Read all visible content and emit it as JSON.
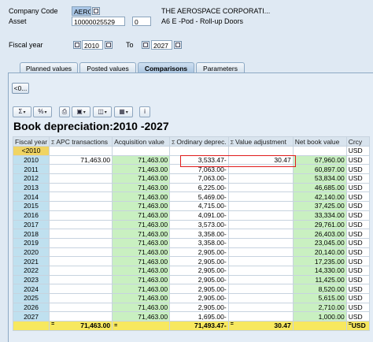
{
  "header": {
    "company_code_label": "Company Code",
    "company_code_value": "AERO",
    "company_name": "THE AEROSPACE CORPORATI...",
    "asset_label": "Asset",
    "asset_value": "10000025529",
    "asset_sub": "0",
    "asset_desc": "A6 E -Pod - Roll-up Doors",
    "fiscal_year_label": "Fiscal year",
    "fiscal_from": "2010",
    "to_label": "To",
    "fiscal_to": "2027"
  },
  "tabs": [
    {
      "label": "Planned values",
      "active": false
    },
    {
      "label": "Posted values",
      "active": false
    },
    {
      "label": "Comparisons",
      "active": true
    },
    {
      "label": "Parameters",
      "active": false
    }
  ],
  "back_button": "<0...",
  "toolbar_icons": [
    "sum-icon",
    "subtotal-icon",
    "print-icon",
    "view-icon",
    "export-icon",
    "layout-icon",
    "info-icon"
  ],
  "report_title": "Book depreciation:2010 -2027",
  "grid": {
    "columns": [
      "Fiscal year",
      "APC transactions",
      "Acquisition value",
      "Ordinary deprec.",
      "Value adjustment",
      "Net book value",
      "Crcy"
    ],
    "rows": [
      {
        "year": "<2010",
        "apc": "",
        "acq": "",
        "ord": "",
        "adj": "",
        "nbv": "",
        "crcy": "USD"
      },
      {
        "year": "2010",
        "apc": "71,463.00",
        "acq": "71,463.00",
        "ord": "3,533.47-",
        "adj": "30.47",
        "nbv": "67,960.00",
        "crcy": "USD"
      },
      {
        "year": "2011",
        "apc": "",
        "acq": "71,463.00",
        "ord": "7,063.00-",
        "adj": "",
        "nbv": "60,897.00",
        "crcy": "USD"
      },
      {
        "year": "2012",
        "apc": "",
        "acq": "71,463.00",
        "ord": "7,063.00-",
        "adj": "",
        "nbv": "53,834.00",
        "crcy": "USD"
      },
      {
        "year": "2013",
        "apc": "",
        "acq": "71,463.00",
        "ord": "6,225.00-",
        "adj": "",
        "nbv": "46,685.00",
        "crcy": "USD"
      },
      {
        "year": "2014",
        "apc": "",
        "acq": "71,463.00",
        "ord": "5,469.00-",
        "adj": "",
        "nbv": "42,140.00",
        "crcy": "USD"
      },
      {
        "year": "2015",
        "apc": "",
        "acq": "71,463.00",
        "ord": "4,715.00-",
        "adj": "",
        "nbv": "37,425.00",
        "crcy": "USD"
      },
      {
        "year": "2016",
        "apc": "",
        "acq": "71,463.00",
        "ord": "4,091.00-",
        "adj": "",
        "nbv": "33,334.00",
        "crcy": "USD"
      },
      {
        "year": "2017",
        "apc": "",
        "acq": "71,463.00",
        "ord": "3,573.00-",
        "adj": "",
        "nbv": "29,761.00",
        "crcy": "USD"
      },
      {
        "year": "2018",
        "apc": "",
        "acq": "71,463.00",
        "ord": "3,358.00-",
        "adj": "",
        "nbv": "26,403.00",
        "crcy": "USD"
      },
      {
        "year": "2019",
        "apc": "",
        "acq": "71,463.00",
        "ord": "3,358.00-",
        "adj": "",
        "nbv": "23,045.00",
        "crcy": "USD"
      },
      {
        "year": "2020",
        "apc": "",
        "acq": "71,463.00",
        "ord": "2,905.00-",
        "adj": "",
        "nbv": "20,140.00",
        "crcy": "USD"
      },
      {
        "year": "2021",
        "apc": "",
        "acq": "71,463.00",
        "ord": "2,905.00-",
        "adj": "",
        "nbv": "17,235.00",
        "crcy": "USD"
      },
      {
        "year": "2022",
        "apc": "",
        "acq": "71,463.00",
        "ord": "2,905.00-",
        "adj": "",
        "nbv": "14,330.00",
        "crcy": "USD"
      },
      {
        "year": "2023",
        "apc": "",
        "acq": "71,463.00",
        "ord": "2,905.00-",
        "adj": "",
        "nbv": "11,425.00",
        "crcy": "USD"
      },
      {
        "year": "2024",
        "apc": "",
        "acq": "71,463.00",
        "ord": "2,905.00-",
        "adj": "",
        "nbv": "8,520.00",
        "crcy": "USD"
      },
      {
        "year": "2025",
        "apc": "",
        "acq": "71,463.00",
        "ord": "2,905.00-",
        "adj": "",
        "nbv": "5,615.00",
        "crcy": "USD"
      },
      {
        "year": "2026",
        "apc": "",
        "acq": "71,463.00",
        "ord": "2,905.00-",
        "adj": "",
        "nbv": "2,710.00",
        "crcy": "USD"
      },
      {
        "year": "2027",
        "apc": "",
        "acq": "71,463.00",
        "ord": "1,695.00-",
        "adj": "",
        "nbv": "1,000.00",
        "crcy": "USD"
      }
    ],
    "total": {
      "marker": "=",
      "apc": "71,463.00",
      "acq_marker": "=",
      "ord": "71,493.47-",
      "adj_marker": "=",
      "adj": "30.47",
      "crcy_marker": "=",
      "crcy": "USD"
    }
  }
}
